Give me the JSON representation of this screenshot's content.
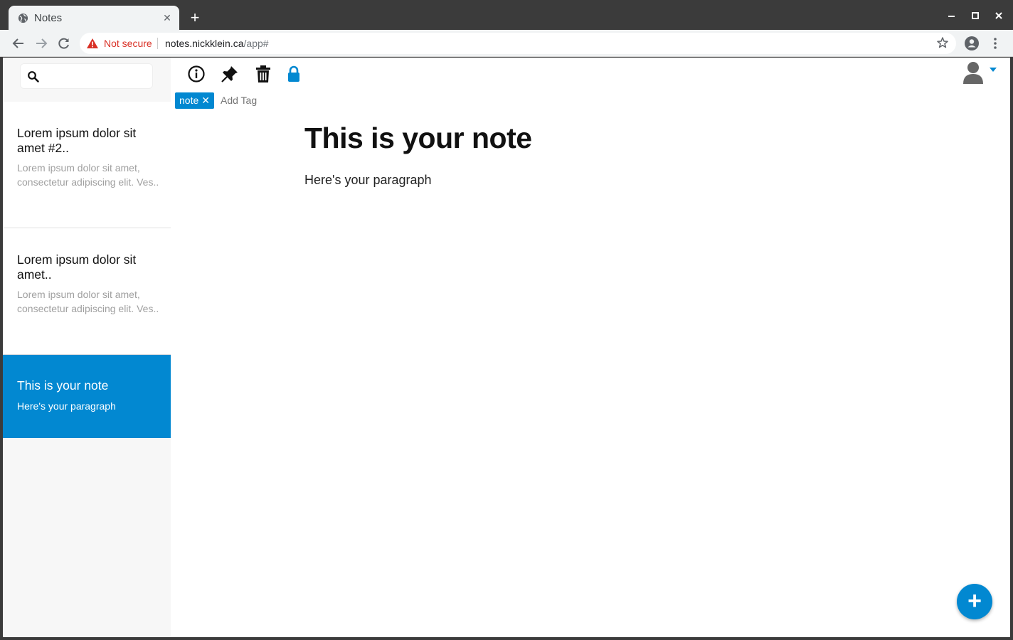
{
  "browser": {
    "tab_title": "Notes",
    "tab_close": "✕",
    "new_tab": "+",
    "security_label": "Not secure",
    "url_host": "notes.nickklein.ca",
    "url_path": "/app#"
  },
  "sidebar": {
    "search_placeholder": "",
    "notes": [
      {
        "title": "Lorem ipsum dolor sit amet #2..",
        "preview": "Lorem ipsum dolor sit amet, consectetur adipiscing elit. Ves.."
      },
      {
        "title": "Lorem ipsum dolor sit amet..",
        "preview": "Lorem ipsum dolor sit amet, consectetur adipiscing elit. Ves.."
      },
      {
        "title": "This is your note",
        "preview": "Here's your paragraph"
      }
    ]
  },
  "editor": {
    "tags": [
      {
        "label": "note",
        "remove": "✕"
      }
    ],
    "add_tag_label": "Add Tag",
    "title": "This is your note",
    "paragraph": "Here's your paragraph",
    "fab_label": "+"
  },
  "colors": {
    "accent": "#0288d1",
    "sidebar_bg": "#f7f7f7",
    "chrome_dark": "#3b3b3b",
    "toolbar_bg": "#f1f3f4",
    "warning_red": "#d93025"
  },
  "icons": [
    "globe-icon",
    "close-icon",
    "plus-icon",
    "minimize-icon",
    "maximize-icon",
    "window-close-icon",
    "back-icon",
    "forward-icon",
    "reload-icon",
    "warning-icon",
    "star-icon",
    "account-icon",
    "menu-icon",
    "search-icon",
    "info-icon",
    "pin-icon",
    "trash-icon",
    "lock-icon",
    "avatar-icon",
    "caret-down-icon"
  ]
}
